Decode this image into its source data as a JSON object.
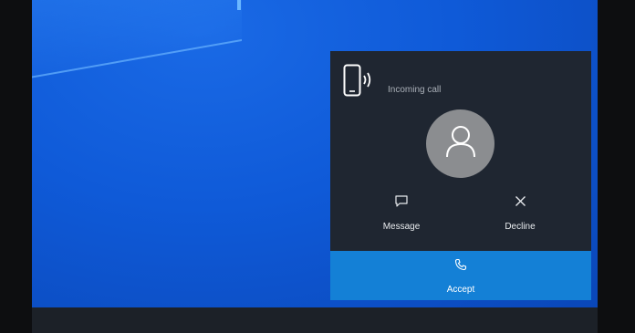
{
  "toast": {
    "title": "Incoming call",
    "actions": {
      "message": {
        "label": "Message",
        "icon": "message-icon"
      },
      "decline": {
        "label": "Decline",
        "icon": "close-icon"
      },
      "accept": {
        "label": "Accept",
        "icon": "phone-icon"
      }
    },
    "header_icon": "ringing-phone-icon",
    "avatar_icon": "person-icon"
  },
  "colors": {
    "desktop_blue": "#0f5ad8",
    "toast_bg": "#1f2631",
    "accept_bg": "#1480d6",
    "avatar_bg": "#8b8d90"
  }
}
